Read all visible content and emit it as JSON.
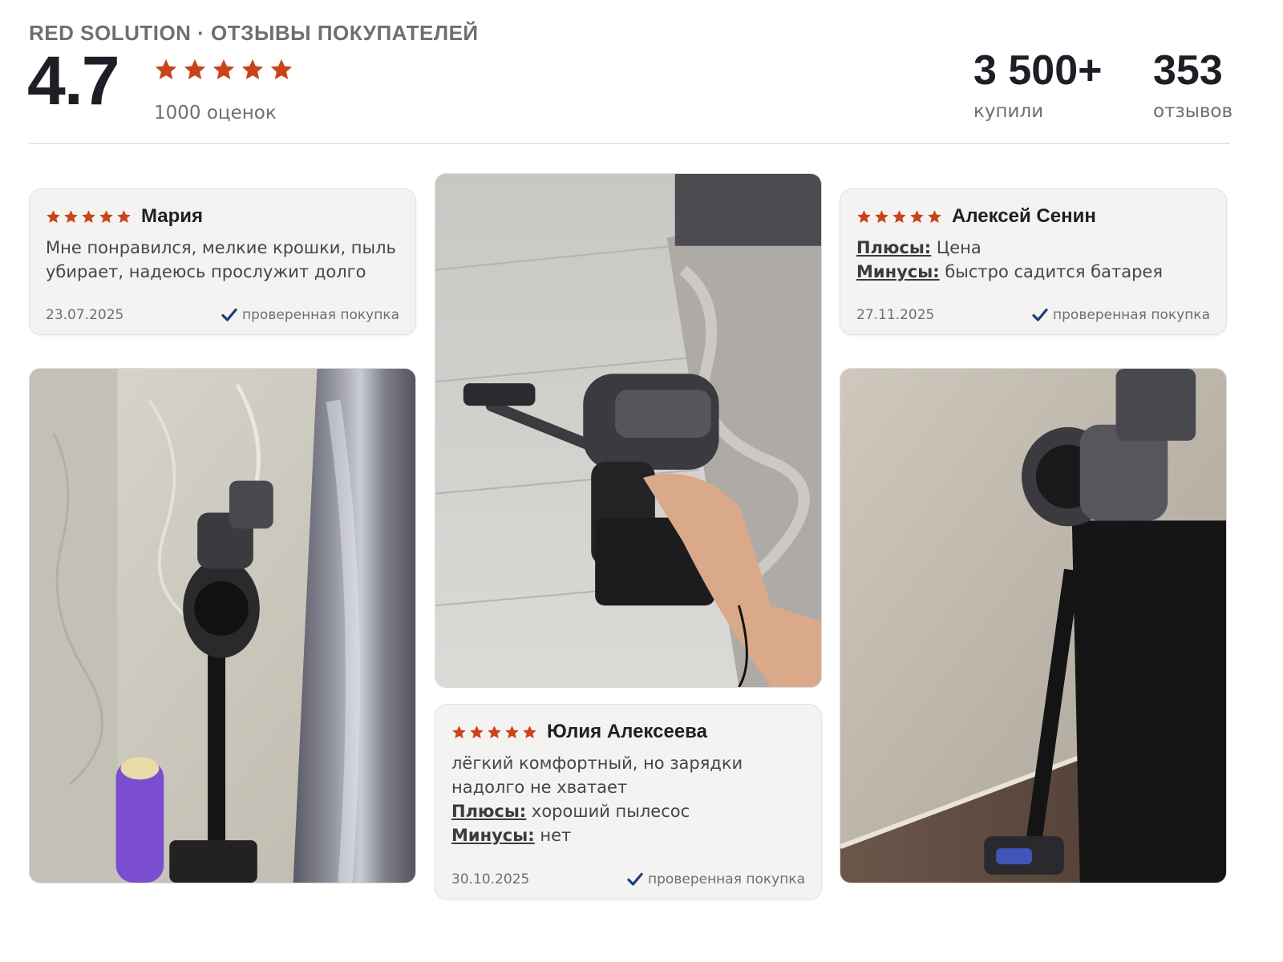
{
  "header": {
    "brand_title": "RED SOLUTION · ОТЗЫВЫ ПОКУПАТЕЛЕЙ",
    "rating": "4.7",
    "stars": 5,
    "ratings_count": "1000 оценок",
    "stats": [
      {
        "value": "3 500+",
        "label": "купили"
      },
      {
        "value": "353",
        "label": "отзывов"
      }
    ]
  },
  "colors": {
    "star": "#c9431b",
    "check": "#1d3a7a",
    "card_bg": "#f4f3f1"
  },
  "reviews": [
    {
      "author": "Мария",
      "stars": 5,
      "text_lines": [
        "Мне понравился, мелкие крошки, пыль",
        "убирает, надеюсь прослужит долго"
      ],
      "date": "23.07.2025",
      "verified": "проверенная покупка"
    },
    {
      "author": "Алексей Сенин",
      "stars": 5,
      "pros_label": "Плюсы:",
      "pros": "Цена",
      "cons_label": "Минусы:",
      "cons": "быстро садится батарея",
      "date": "27.11.2025",
      "verified": "проверенная покупка"
    },
    {
      "author": "Юлия Алексеева",
      "stars": 5,
      "text_lines": [
        "лёгкий комфортный, но зарядки",
        "надолго не хватает"
      ],
      "pros_label": "Плюсы:",
      "pros": "хороший пылесос",
      "cons_label": "Минусы:",
      "cons": "нет",
      "date": "30.10.2025",
      "verified": "проверенная покупка"
    }
  ],
  "photos": [
    {
      "subject": "Cordless vacuum standing in corner by grey curtain"
    },
    {
      "subject": "Hand holding cordless vacuum over light tiled floor and rug"
    },
    {
      "subject": "Cordless vacuum leaning against wall next to black cabinet"
    }
  ]
}
